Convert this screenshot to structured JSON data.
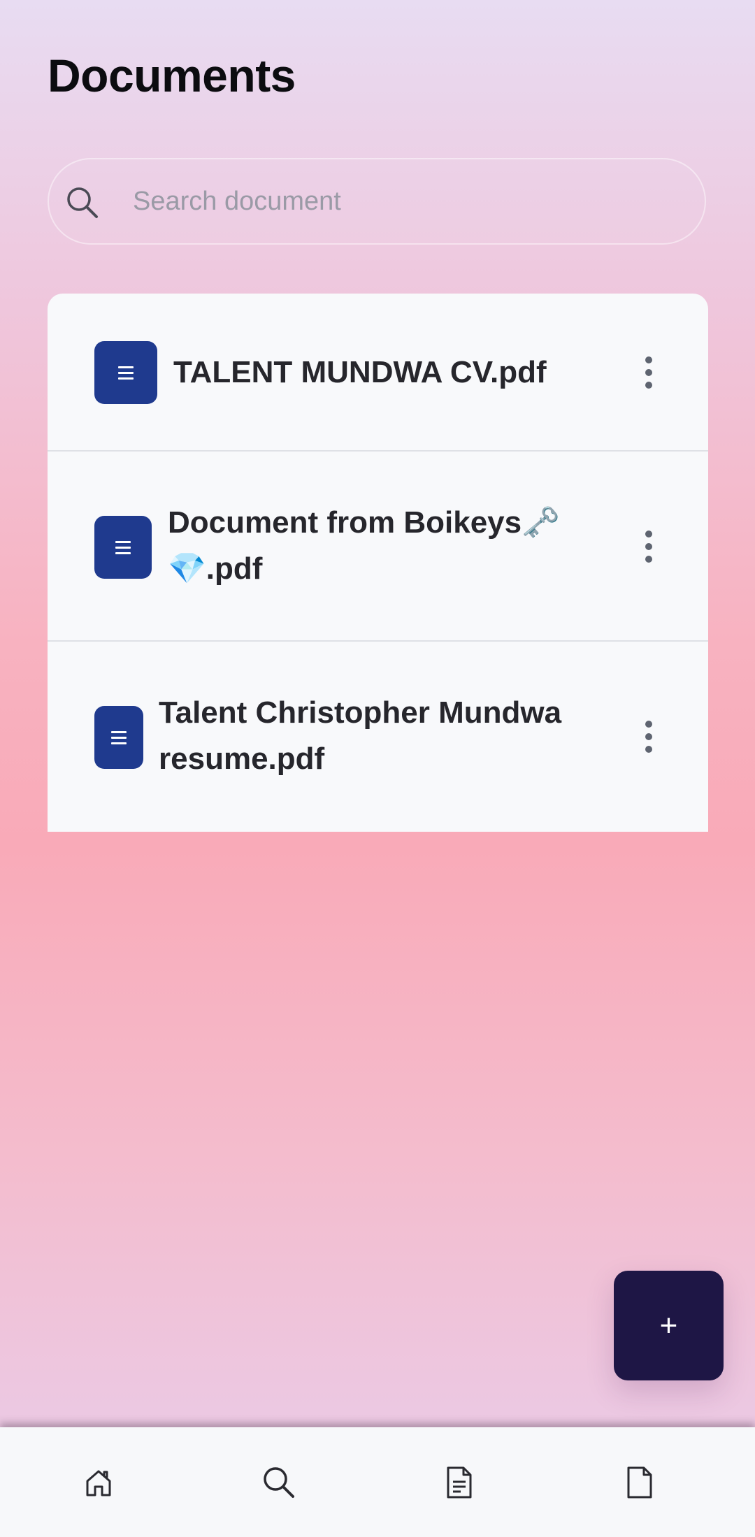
{
  "header": {
    "title": "Documents"
  },
  "search": {
    "placeholder": "Search document",
    "value": ""
  },
  "documents": [
    {
      "name": "TALENT MUNDWA CV.pdf"
    },
    {
      "name": "Document from Boikeys🗝️💎.pdf"
    },
    {
      "name": "Talent Christopher Mundwa resume.pdf"
    }
  ],
  "fab": {
    "label": "+"
  },
  "bottom_nav": {
    "items": [
      {
        "icon": "home-icon"
      },
      {
        "icon": "search-icon"
      },
      {
        "icon": "document-text-icon"
      },
      {
        "icon": "file-icon"
      }
    ]
  },
  "colors": {
    "accent": "#1f3a8e",
    "fab": "#1e1645",
    "card": "#f8f9fb"
  }
}
